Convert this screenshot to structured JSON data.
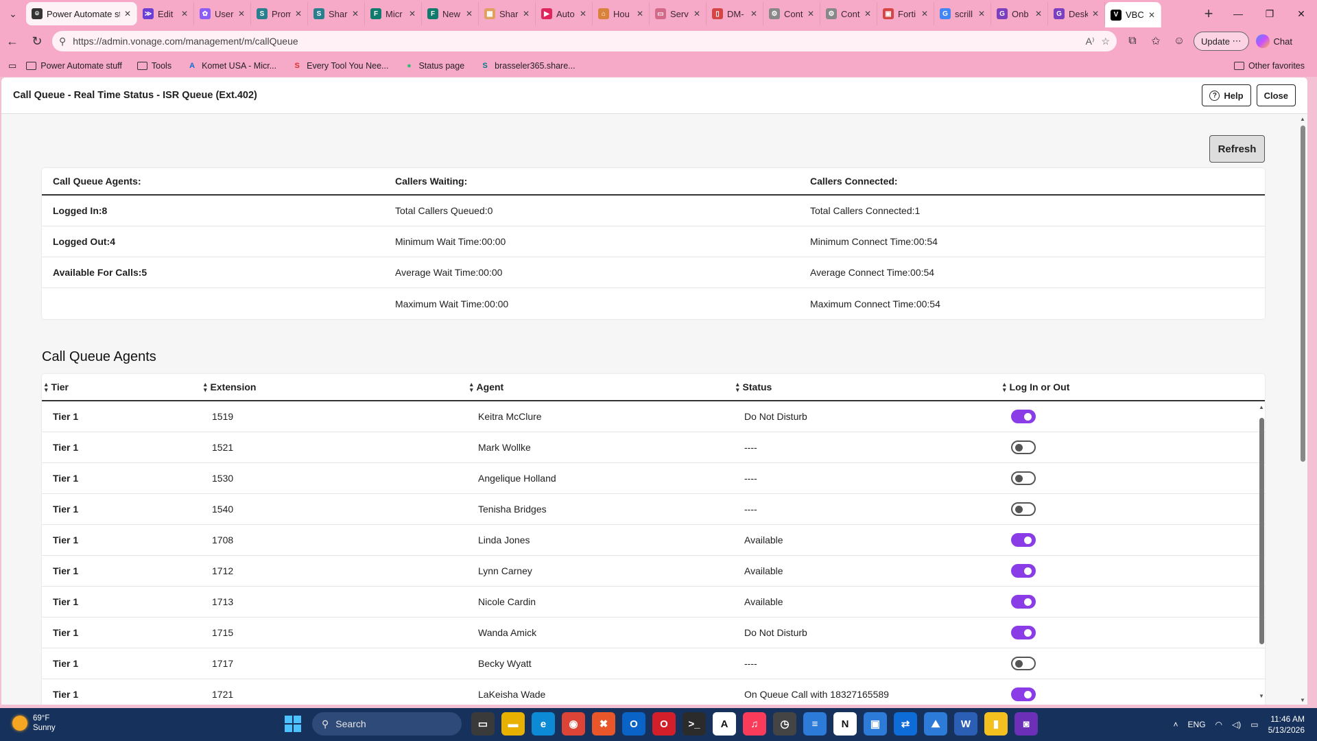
{
  "browser": {
    "tabs": [
      {
        "label": "Power Automate stuff",
        "icon_color": "#333333",
        "icon_glyph": "⌾"
      },
      {
        "label": "Edit",
        "icon_color": "#6b3fd4",
        "icon_glyph": "≫"
      },
      {
        "label": "User",
        "icon_color": "#8b5cf6",
        "icon_glyph": "✿"
      },
      {
        "label": "Prom",
        "icon_color": "#2a7f8f",
        "icon_glyph": "S"
      },
      {
        "label": "Shar",
        "icon_color": "#2a7f8f",
        "icon_glyph": "S"
      },
      {
        "label": "Micr",
        "icon_color": "#0f7b6c",
        "icon_glyph": "F"
      },
      {
        "label": "New",
        "icon_color": "#0f7b6c",
        "icon_glyph": "F"
      },
      {
        "label": "Shar",
        "icon_color": "#e0a060",
        "icon_glyph": "▦"
      },
      {
        "label": "Auto",
        "icon_color": "#e0245e",
        "icon_glyph": "▶"
      },
      {
        "label": "Hou",
        "icon_color": "#d9823b",
        "icon_glyph": "⌂"
      },
      {
        "label": "Serv",
        "icon_color": "#d46a8a",
        "icon_glyph": "▭"
      },
      {
        "label": "DM-",
        "icon_color": "#d64545",
        "icon_glyph": "▯"
      },
      {
        "label": "Cont",
        "icon_color": "#888888",
        "icon_glyph": "⚙"
      },
      {
        "label": "Cont",
        "icon_color": "#888888",
        "icon_glyph": "⚙"
      },
      {
        "label": "Forti",
        "icon_color": "#d64545",
        "icon_glyph": "▣"
      },
      {
        "label": "scrill",
        "icon_color": "#4285f4",
        "icon_glyph": "G"
      },
      {
        "label": "Onb",
        "icon_color": "#7b3fbf",
        "icon_glyph": "G"
      },
      {
        "label": "Desk",
        "icon_color": "#7b3fbf",
        "icon_glyph": "G"
      },
      {
        "label": "VBC",
        "icon_color": "#000000",
        "icon_glyph": "V"
      }
    ],
    "active_tab_index": 18,
    "url": "https://admin.vonage.com/management/m/callQueue",
    "update_label": "Update",
    "chat_label": "Chat",
    "favorites": [
      {
        "label": "Power Automate stuff",
        "type": "folder"
      },
      {
        "label": "Tools",
        "type": "folder"
      },
      {
        "label": "Komet USA - Micr...",
        "type": "azure"
      },
      {
        "label": "Every Tool You Nee...",
        "type": "s-logo"
      },
      {
        "label": "Status page",
        "type": "dot"
      },
      {
        "label": "brasseler365.share...",
        "type": "sharepoint"
      }
    ],
    "other_favorites": "Other favorites"
  },
  "page": {
    "title": "Call Queue - Real Time Status - ISR Queue (Ext.402)",
    "help_label": "Help",
    "close_label": "Close",
    "refresh_label": "Refresh"
  },
  "summary": {
    "headers": [
      "Call Queue Agents:",
      "Callers Waiting:",
      "Callers Connected:"
    ],
    "rows": [
      [
        "Logged In:8",
        "Total Callers Queued:0",
        "Total Callers Connected:1"
      ],
      [
        "Logged Out:4",
        "Minimum Wait Time:00:00",
        "Minimum Connect Time:00:54"
      ],
      [
        "Available For Calls:5",
        "Average Wait Time:00:00",
        "Average Connect Time:00:54"
      ],
      [
        "",
        "Maximum Wait Time:00:00",
        "Maximum Connect Time:00:54"
      ]
    ]
  },
  "agents": {
    "title": "Call Queue Agents",
    "columns": [
      "Tier",
      "Extension",
      "Agent",
      "Status",
      "Log In or Out"
    ],
    "rows": [
      {
        "tier": "Tier 1",
        "ext": "1519",
        "agent": "Keitra McClure",
        "status": "Do Not Disturb",
        "logged_in": true
      },
      {
        "tier": "Tier 1",
        "ext": "1521",
        "agent": "Mark Wollke",
        "status": "----",
        "logged_in": false
      },
      {
        "tier": "Tier 1",
        "ext": "1530",
        "agent": "Angelique Holland",
        "status": "----",
        "logged_in": false
      },
      {
        "tier": "Tier 1",
        "ext": "1540",
        "agent": "Tenisha Bridges",
        "status": "----",
        "logged_in": false
      },
      {
        "tier": "Tier 1",
        "ext": "1708",
        "agent": "Linda Jones",
        "status": "Available",
        "logged_in": true
      },
      {
        "tier": "Tier 1",
        "ext": "1712",
        "agent": "Lynn Carney",
        "status": "Available",
        "logged_in": true
      },
      {
        "tier": "Tier 1",
        "ext": "1713",
        "agent": "Nicole Cardin",
        "status": "Available",
        "logged_in": true
      },
      {
        "tier": "Tier 1",
        "ext": "1715",
        "agent": "Wanda Amick",
        "status": "Do Not Disturb",
        "logged_in": true
      },
      {
        "tier": "Tier 1",
        "ext": "1717",
        "agent": "Becky Wyatt",
        "status": "----",
        "logged_in": false
      },
      {
        "tier": "Tier 1",
        "ext": "1721",
        "agent": "LaKeisha Wade",
        "status": "On Queue Call with 18327165589",
        "logged_in": true
      }
    ]
  },
  "colors": {
    "toggle_on": "#8a3ce6",
    "browser_chrome": "#f7a9c8",
    "taskbar": "#16325c"
  },
  "taskbar": {
    "weather_temp": "69°F",
    "weather_desc": "Sunny",
    "search_placeholder": "Search",
    "language": "ENG",
    "time": "11:46 AM",
    "date": "5/13/2026",
    "apps": [
      {
        "name": "task-view",
        "color": "#3a3a3a",
        "glyph": "▭"
      },
      {
        "name": "file-explorer",
        "color": "#e8b100",
        "glyph": "▬"
      },
      {
        "name": "edge",
        "color": "#0c8ad6",
        "glyph": "e"
      },
      {
        "name": "chrome",
        "color": "#db4437",
        "glyph": "◉"
      },
      {
        "name": "app-orange",
        "color": "#e8562a",
        "glyph": "✖"
      },
      {
        "name": "outlook",
        "color": "#0a64c8",
        "glyph": "O"
      },
      {
        "name": "opera",
        "color": "#d21f2a",
        "glyph": "O"
      },
      {
        "name": "terminal",
        "color": "#2b2b2b",
        "glyph": ">_"
      },
      {
        "name": "app-a",
        "color": "#ffffff",
        "glyph": "A"
      },
      {
        "name": "music",
        "color": "#fa3c5a",
        "glyph": "♫"
      },
      {
        "name": "app-clock",
        "color": "#444444",
        "glyph": "◷"
      },
      {
        "name": "notepad",
        "color": "#2c7bd8",
        "glyph": "≡"
      },
      {
        "name": "notion",
        "color": "#ffffff",
        "glyph": "N"
      },
      {
        "name": "app-monitor",
        "color": "#2c7bd8",
        "glyph": "▣"
      },
      {
        "name": "teamviewer",
        "color": "#0e6cd8",
        "glyph": "⇄"
      },
      {
        "name": "photos",
        "color": "#2c7bd8",
        "glyph": "⛰"
      },
      {
        "name": "word",
        "color": "#2b5fb5",
        "glyph": "W"
      },
      {
        "name": "app-yellow",
        "color": "#f4c020",
        "glyph": "▮"
      },
      {
        "name": "app-purple",
        "color": "#6b2fb8",
        "glyph": "◙"
      }
    ]
  }
}
